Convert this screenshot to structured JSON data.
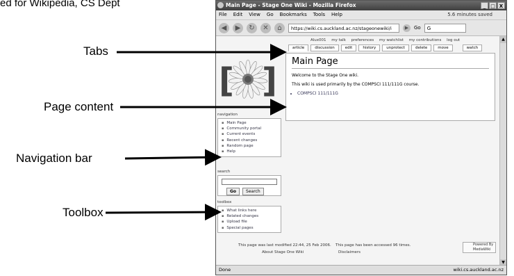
{
  "caption": "ed for Wikipedia, CS Dept",
  "callouts": {
    "tabs": "Tabs",
    "page_content": "Page content",
    "navigation_bar": "Navigation bar",
    "toolbox": "Toolbox"
  },
  "browser": {
    "title": "Main Page - Stage One Wiki - Mozilla Firefox",
    "window_buttons": [
      "_",
      "□",
      "X"
    ],
    "menu": [
      "File",
      "Edit",
      "View",
      "Go",
      "Bookmarks",
      "Tools",
      "Help"
    ],
    "saved_status": "5.6 minutes saved",
    "url": "https://wiki.cs.auckland.ac.nz/stageonewiki/i",
    "go_label": "Go",
    "search_placeholder": "G",
    "status_left": "Done",
    "status_right": "wiki.cs.auckland.ac.nz"
  },
  "wiki": {
    "personal_tools": [
      "Alux001",
      "my talk",
      "preferences",
      "my watchlist",
      "my contributions",
      "log out"
    ],
    "tabs": [
      "article",
      "discussion",
      "edit",
      "history",
      "unprotect",
      "delete",
      "move",
      "watch"
    ],
    "page_title": "Main Page",
    "welcome": "Welcome to the Stage One wiki.",
    "usage": "This wiki is used primarily by the COMPSCI 111/111G course.",
    "list_item": "COMPSCI 111/111G",
    "navigation_heading": "navigation",
    "navigation_items": [
      "Main Page",
      "Community portal",
      "Current events",
      "Recent changes",
      "Random page",
      "Help"
    ],
    "search_heading": "search",
    "search_go": "Go",
    "search_search": "Search",
    "toolbox_heading": "toolbox",
    "toolbox_items": [
      "What links here",
      "Related changes",
      "Upload file",
      "Special pages"
    ],
    "footer_modified": "This page was last modified 22:44, 25 Feb 2006.",
    "footer_accessed": "This page has been accessed 96 times.",
    "footer_about": "About Stage One Wiki",
    "footer_disclaimers": "Disclaimers",
    "powered_by": "Powered By MediaWiki"
  }
}
